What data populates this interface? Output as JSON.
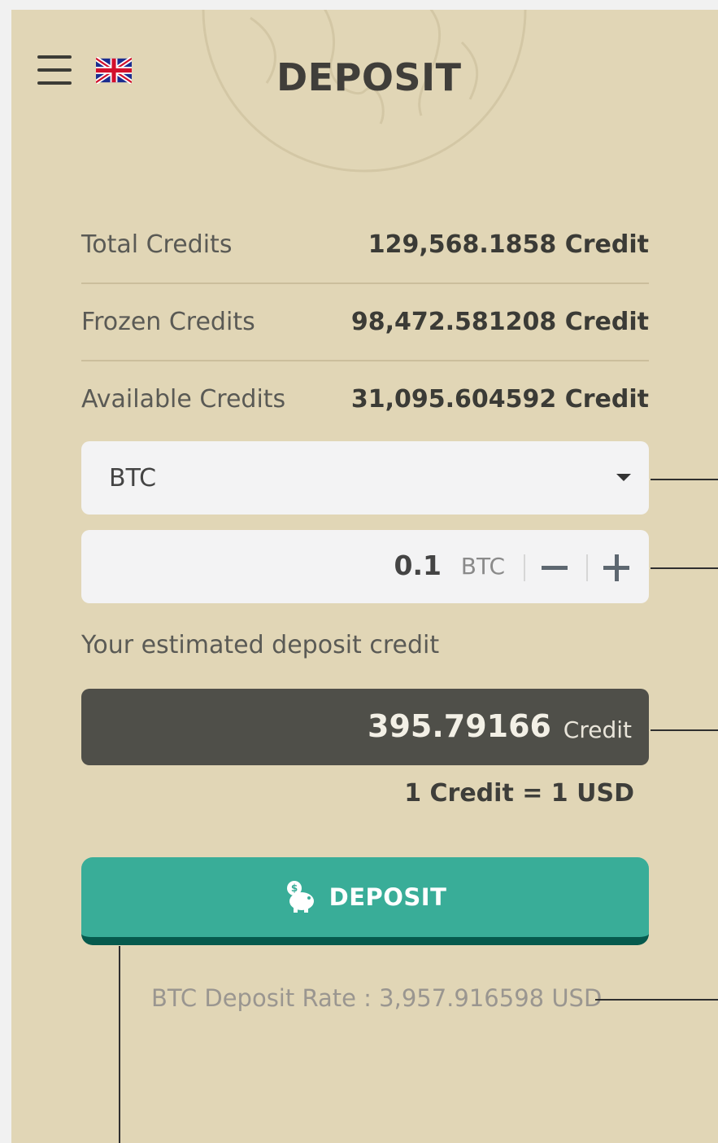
{
  "header": {
    "title": "DEPOSIT",
    "menu_icon": "hamburger-menu-icon",
    "language_icon": "uk-flag-icon"
  },
  "credits": [
    {
      "label": "Total Credits",
      "value": "129,568.1858 Credit"
    },
    {
      "label": "Frozen Credits",
      "value": "98,472.581208 Credit"
    },
    {
      "label": "Available Credits",
      "value": "31,095.604592 Credit"
    }
  ],
  "currency_select": {
    "selected": "BTC",
    "icon": "caret-down-icon"
  },
  "amount": {
    "value": "0.1",
    "unit": "BTC",
    "minus_icon": "minus-icon",
    "plus_icon": "plus-icon"
  },
  "estimate": {
    "label": "Your estimated deposit credit",
    "value": "395.79166",
    "unit": "Credit",
    "rate_note": "1 Credit = 1 USD"
  },
  "deposit_button": {
    "label": "DEPOSIT",
    "icon": "piggy-bank-icon"
  },
  "deposit_rate": "BTC Deposit Rate : 3,957.916598 USD",
  "colors": {
    "background": "#e1d6b6",
    "accent": "#39ad98",
    "accent_dark": "#065a4d",
    "estimate_box": "#4f4f49"
  }
}
